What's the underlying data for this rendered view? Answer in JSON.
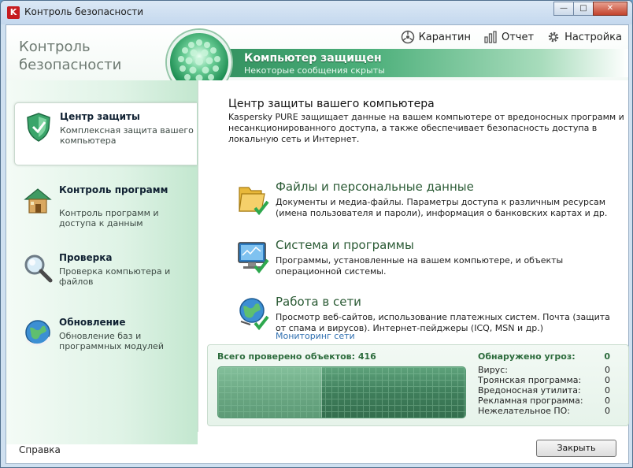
{
  "window": {
    "title": "Контроль безопасности",
    "close_glyph": "✕",
    "max_glyph": "□",
    "min_glyph": "—"
  },
  "brand": {
    "line1": "Контроль",
    "line2": "безопасности"
  },
  "toplinks": {
    "quarantine": "Карантин",
    "report": "Отчет",
    "settings": "Настройка"
  },
  "status": {
    "title": "Компьютер защищен",
    "subtitle": "Некоторые сообщения скрыты"
  },
  "sidebar": {
    "items": [
      {
        "title": "Центр защиты",
        "desc": "Комплексная защита вашего компьютера",
        "icon": "shield-icon",
        "active": true
      },
      {
        "title": "Контроль программ",
        "desc": "Контроль программ и доступа к данным",
        "icon": "house-icon"
      },
      {
        "title": "Проверка",
        "desc": "Проверка компьютера и файлов",
        "icon": "magnifier-icon"
      },
      {
        "title": "Обновление",
        "desc": "Обновление баз и программных модулей",
        "icon": "globe-update-icon"
      }
    ]
  },
  "main": {
    "title": "Центр защиты вашего компьютера",
    "desc": "Kaspersky PURE защищает данные на вашем компьютере от вредоносных программ и несанкционированного доступа, а также обеспечивает безопасность доступа в локальную сеть и Интернет.",
    "sections": [
      {
        "title": "Файлы и персональные данные",
        "desc": "Документы и медиа-файлы. Параметры доступа к различным ресурсам (имена пользователя и пароли), информация о банковских картах и др.",
        "icon": "folder-icon"
      },
      {
        "title": "Система и программы",
        "desc": "Программы, установленные на вашем компьютере, и объекты операционной системы.",
        "icon": "monitor-icon"
      },
      {
        "title": "Работа в сети",
        "desc": "Просмотр веб-сайтов, использование платежных систем. Почта (защита от спама и вирусов). Интернет-пейджеры (ICQ, MSN и др.)",
        "icon": "network-globe-icon",
        "link": "Мониторинг сети"
      }
    ]
  },
  "stats": {
    "checked_label": "Всего проверено объектов: 416",
    "scan_progress_fraction": 0.42,
    "threats_label": "Обнаружено угроз:",
    "threats_total": "0",
    "rows": [
      {
        "label": "Вирус:",
        "value": "0"
      },
      {
        "label": "Троянская программа:",
        "value": "0"
      },
      {
        "label": "Вредоносная утилита:",
        "value": "0"
      },
      {
        "label": "Рекламная программа:",
        "value": "0"
      },
      {
        "label": "Нежелательное ПО:",
        "value": "0"
      }
    ]
  },
  "footer": {
    "help": "Справка",
    "close": "Закрыть"
  },
  "colors": {
    "accent_green": "#2f8d5c",
    "link_blue": "#2f6fb0",
    "title_bar": "#c4d8ee"
  }
}
